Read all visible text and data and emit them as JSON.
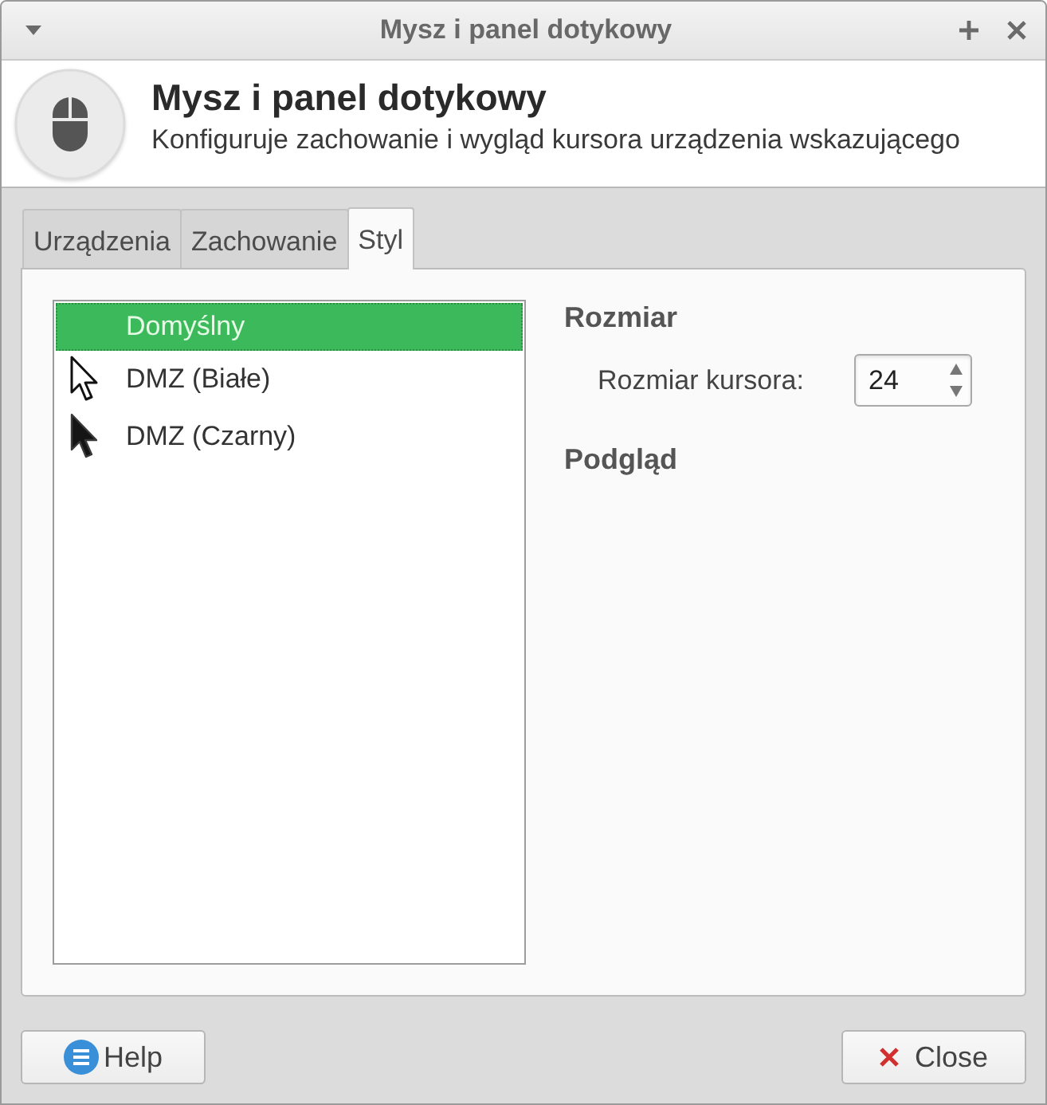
{
  "window": {
    "title": "Mysz i panel dotykowy"
  },
  "header": {
    "title": "Mysz i panel dotykowy",
    "subtitle": "Konfiguruje zachowanie i wygląd kursora urządzenia wskazującego"
  },
  "tabs": [
    {
      "label": "Urządzenia",
      "selected": false
    },
    {
      "label": "Zachowanie",
      "selected": false
    },
    {
      "label": "Styl",
      "selected": true
    }
  ],
  "cursor_themes": [
    {
      "name": "Domyślny",
      "kind": "none",
      "selected": true
    },
    {
      "name": "DMZ (Białe)",
      "kind": "hollow",
      "selected": false
    },
    {
      "name": "DMZ (Czarny)",
      "kind": "solid",
      "selected": false
    }
  ],
  "size_section": {
    "heading": "Rozmiar",
    "label": "Rozmiar kursora:",
    "value": "24"
  },
  "preview_section": {
    "heading": "Podgląd"
  },
  "buttons": [
    {
      "label": "Help",
      "kind": "help"
    },
    {
      "label": "Close",
      "kind": "close"
    }
  ]
}
